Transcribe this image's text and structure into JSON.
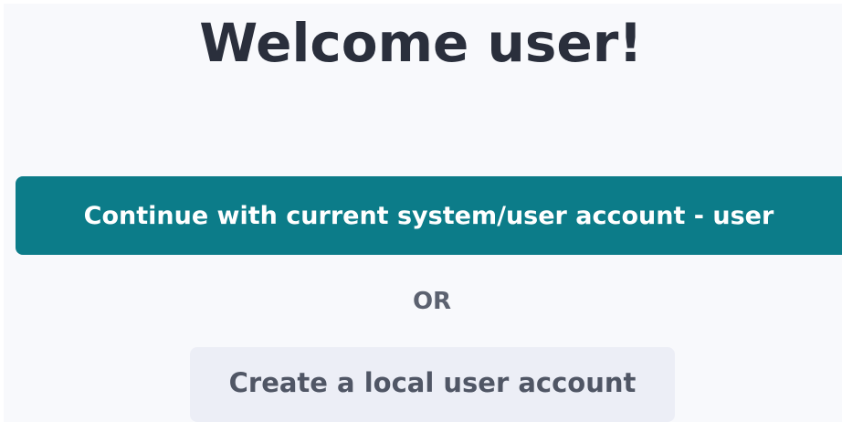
{
  "header": {
    "title": "Welcome user!"
  },
  "actions": {
    "primary_label": "Continue with current system/user account - user",
    "separator": "OR",
    "secondary_label": "Create a local user account"
  },
  "colors": {
    "background": "#f8f9fc",
    "title_text": "#2a2f3c",
    "primary_button": "#0c7c89",
    "primary_button_text": "#ffffff",
    "separator_text": "#5c6270",
    "secondary_button": "#eceef6",
    "secondary_button_text": "#505665"
  }
}
